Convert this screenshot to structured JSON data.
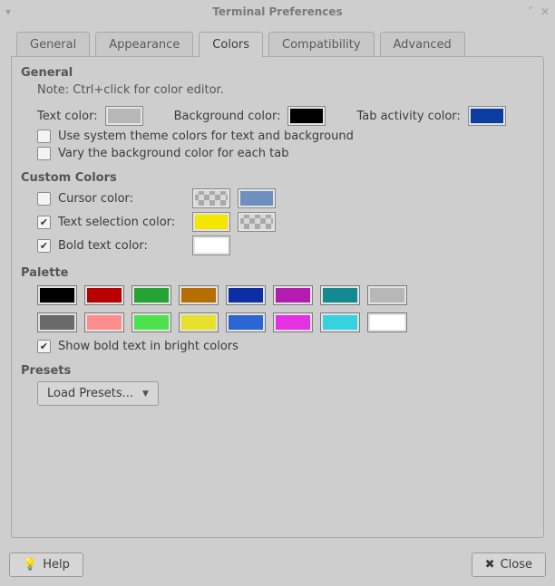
{
  "window": {
    "title": "Terminal Preferences"
  },
  "tabs": {
    "general": "General",
    "appearance": "Appearance",
    "colors": "Colors",
    "compatibility": "Compatibility",
    "advanced": "Advanced"
  },
  "general": {
    "heading": "General",
    "note": "Note: Ctrl+click for color editor.",
    "text_color_label": "Text color:",
    "text_color": "#b7b7b7",
    "background_color_label": "Background color:",
    "background_color": "#000000",
    "tab_activity_label": "Tab activity color:",
    "tab_activity_color": "#0b3ea0",
    "use_system_colors_label": "Use system theme colors for text and background",
    "use_system_colors_checked": false,
    "vary_background_label": "Vary the background color for each tab",
    "vary_background_checked": false
  },
  "custom": {
    "heading": "Custom Colors",
    "cursor_label": "Cursor color:",
    "cursor_checked": false,
    "cursor_color2": "#6e8fbf",
    "selection_label": "Text selection color:",
    "selection_checked": true,
    "selection_color": "#f5e600",
    "bold_label": "Bold text color:",
    "bold_checked": true,
    "bold_color": "#ffffff"
  },
  "palette": {
    "heading": "Palette",
    "colors": [
      "#000000",
      "#b80000",
      "#26a335",
      "#b76e00",
      "#0b2ea5",
      "#b41bb1",
      "#138a8f",
      "#b7b7b7",
      "#6a6a6a",
      "#ff8d8d",
      "#4de24d",
      "#e7e12e",
      "#2c66d3",
      "#e431e4",
      "#36d2e0",
      "#ffffff"
    ],
    "show_bold_bright_label": "Show bold text in bright colors",
    "show_bold_bright_checked": true
  },
  "presets": {
    "heading": "Presets",
    "load_label": "Load Presets..."
  },
  "buttons": {
    "help": "Help",
    "close": "Close"
  }
}
